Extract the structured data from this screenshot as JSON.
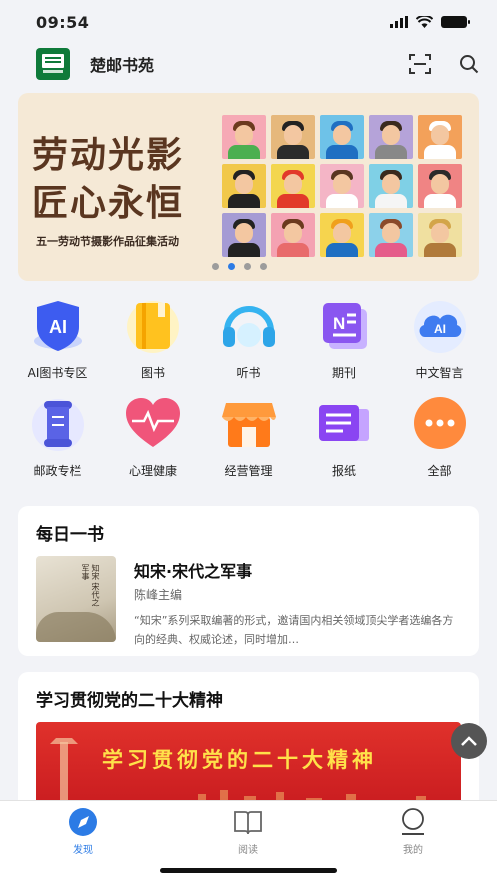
{
  "status": {
    "time": "09:54"
  },
  "app": {
    "title": "楚邮书苑",
    "icons": [
      "scan-icon",
      "search-icon"
    ]
  },
  "banner": {
    "title_line1": "劳动光影",
    "title_line2": "匠心永恒",
    "subtitle": "五一劳动节摄影作品征集活动",
    "slide_count": 4,
    "active_slide": 2
  },
  "menu": {
    "row1": [
      {
        "label": "AI图书专区",
        "icon": "ai-badge-icon"
      },
      {
        "label": "图书",
        "icon": "book-icon"
      },
      {
        "label": "听书",
        "icon": "headphones-icon"
      },
      {
        "label": "期刊",
        "icon": "journal-icon"
      },
      {
        "label": "中文智言",
        "icon": "ai-cloud-icon"
      }
    ],
    "row2": [
      {
        "label": "邮政专栏",
        "icon": "scroll-icon"
      },
      {
        "label": "心理健康",
        "icon": "heart-pulse-icon"
      },
      {
        "label": "经营管理",
        "icon": "shop-icon"
      },
      {
        "label": "报纸",
        "icon": "newspaper-icon"
      },
      {
        "label": "全部",
        "icon": "more-icon"
      }
    ]
  },
  "daily": {
    "header": "每日一书",
    "book_title": "知宋·宋代之军事",
    "author": "陈峰主编",
    "description": "“知宋”系列采取编著的形式，邀请国内相关领域顶尖学者选编各方向的经典、权威论述，同时增加…",
    "cover_text": "知宋 宋代之军事"
  },
  "study": {
    "header": "学习贯彻党的二十大精神",
    "banner_text": "学习贯彻党的二十大精神"
  },
  "tabs": [
    {
      "label": "发现",
      "icon": "compass-icon",
      "active": true
    },
    {
      "label": "阅读",
      "icon": "open-book-icon",
      "active": false
    },
    {
      "label": "我的",
      "icon": "profile-icon",
      "active": false
    }
  ],
  "colors": {
    "accent": "#2c7be5",
    "brand_green": "#0f7a3a",
    "festival_red": "#d4241f"
  }
}
